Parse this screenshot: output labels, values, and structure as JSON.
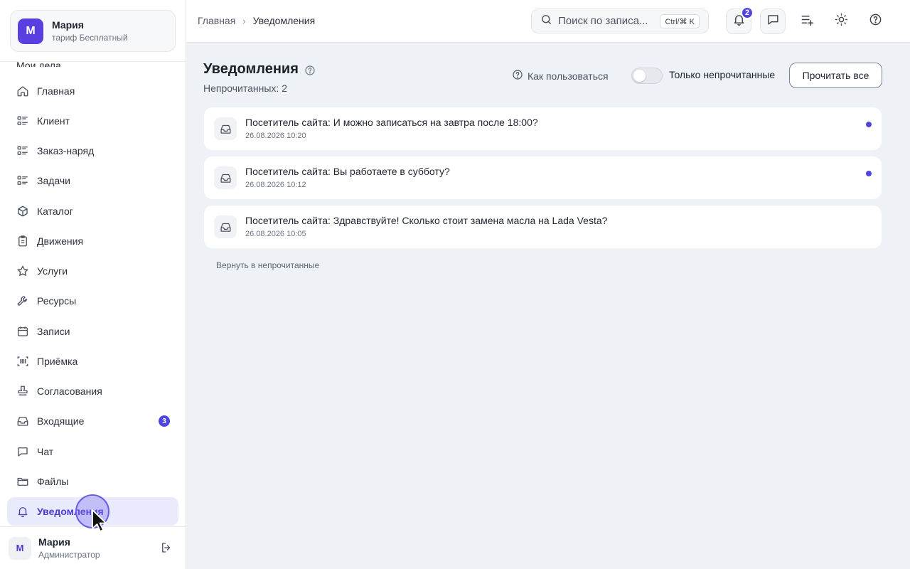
{
  "account": {
    "initial": "М",
    "name": "Мария",
    "plan": "тариф Бесплатный"
  },
  "sidebar": {
    "partial_label": "Мои дела",
    "items": [
      {
        "label": "Главная",
        "icon": "home-icon"
      },
      {
        "label": "Клиент",
        "icon": "list-icon"
      },
      {
        "label": "Заказ-наряд",
        "icon": "list-icon"
      },
      {
        "label": "Задачи",
        "icon": "list-icon"
      },
      {
        "label": "Каталог",
        "icon": "box-icon"
      },
      {
        "label": "Движения",
        "icon": "clipboard-icon"
      },
      {
        "label": "Услуги",
        "icon": "star-icon"
      },
      {
        "label": "Ресурсы",
        "icon": "wrench-icon"
      },
      {
        "label": "Записи",
        "icon": "calendar-icon"
      },
      {
        "label": "Приёмка",
        "icon": "barcode-icon"
      },
      {
        "label": "Согласования",
        "icon": "stamp-icon"
      },
      {
        "label": "Входящие",
        "icon": "inbox-icon",
        "badge": "3"
      },
      {
        "label": "Чат",
        "icon": "chat-icon"
      },
      {
        "label": "Файлы",
        "icon": "folder-icon"
      },
      {
        "label": "Уведомления",
        "icon": "bell-icon",
        "active": true
      }
    ]
  },
  "user": {
    "initial": "М",
    "name": "Мария",
    "role": "Администратор"
  },
  "topbar": {
    "breadcrumb_home": "Главная",
    "breadcrumb_current": "Уведомления",
    "search_placeholder": "Поиск по записа...",
    "search_shortcut": "Ctrl/⌘ K",
    "notifications_badge": "2"
  },
  "main": {
    "title": "Уведомления",
    "unread_count": "Непрочитанных: 2",
    "howto_label": "Как пользоваться",
    "unread_only_label": "Только непрочитанные",
    "unread_only_enabled": false,
    "read_all_label": "Прочитать все",
    "restore_label": "Вернуть в непрочитанные",
    "notifications": [
      {
        "text": "Посетитель сайта: И можно записаться на завтра после 18:00?",
        "time": "26.08.2026 10:20",
        "unread": true
      },
      {
        "text": "Посетитель сайта: Вы работаете в субботу?",
        "time": "26.08.2026 10:12",
        "unread": true
      },
      {
        "text": "Посетитель сайта: Здравствуйте! Сколько стоит замена масла на Lada Vesta?",
        "time": "26.08.2026 10:05",
        "unread": false
      }
    ]
  },
  "colors": {
    "accent": "#5145e0",
    "active_bg": "#e9ebfd",
    "page_bg": "#eef1f5"
  }
}
